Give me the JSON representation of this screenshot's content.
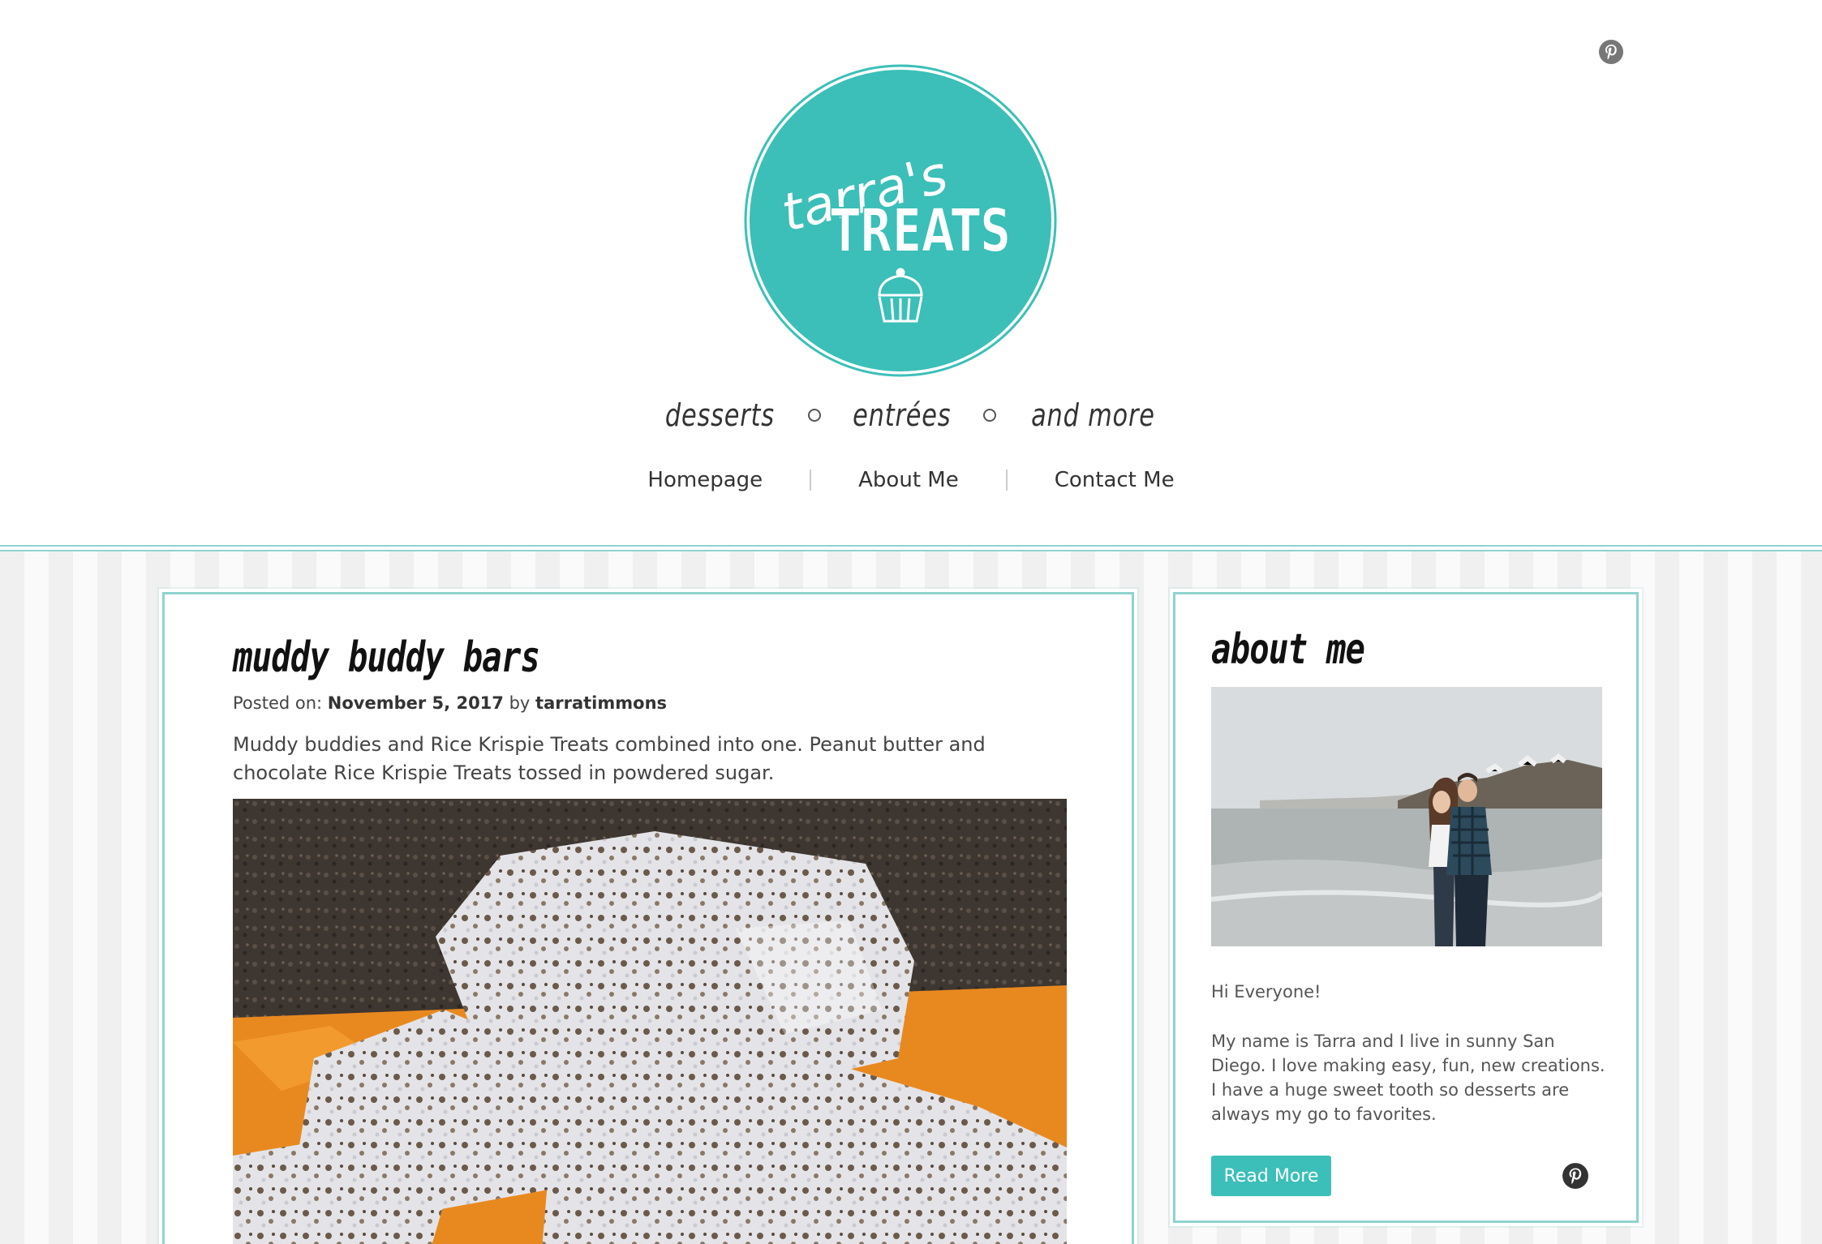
{
  "brand": {
    "logo_top": "tarra's",
    "logo_bottom": "TREATS",
    "primary_color": "#3bbfb8",
    "tagline": [
      "desserts",
      "entrées",
      "and more"
    ]
  },
  "header": {
    "social_icon": "pinterest-icon"
  },
  "nav": {
    "items": [
      "Homepage",
      "About Me",
      "Contact Me"
    ]
  },
  "post": {
    "title": "muddy buddy bars",
    "posted_label": "Posted on:",
    "date": "November 5, 2017",
    "by_label": "by",
    "author": "tarratimmons",
    "excerpt": "Muddy buddies and Rice Krispie Treats combined into one. Peanut butter and chocolate Rice Krispie Treats tossed in powdered sugar."
  },
  "sidebar": {
    "title": "about me",
    "greeting": "Hi Everyone!",
    "body": "My name is Tarra and I live in sunny San Diego. I love making easy, fun, new creations. I have a huge sweet tooth so desserts are always my go to favorites.",
    "button_label": "Read More",
    "social_icon": "pinterest-icon"
  }
}
